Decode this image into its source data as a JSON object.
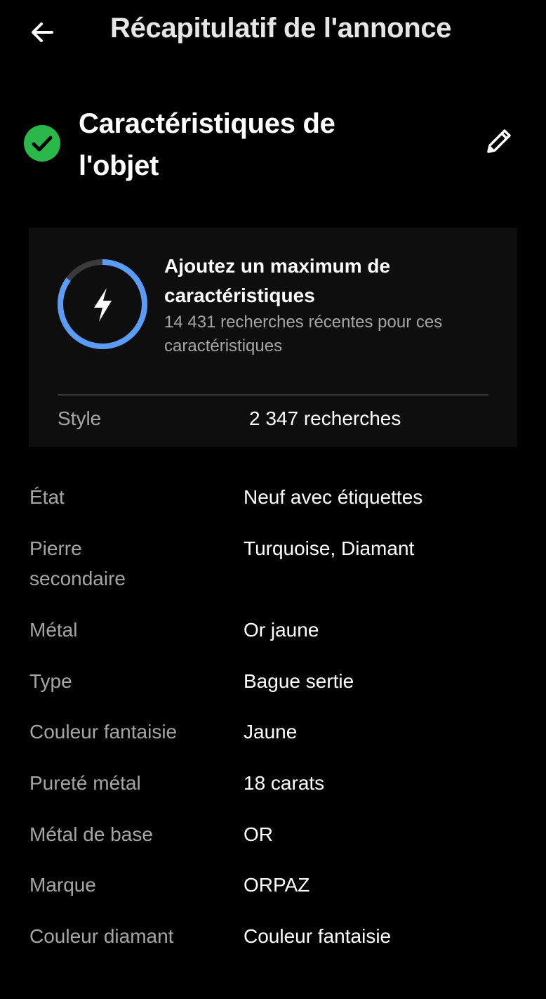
{
  "header": {
    "back_icon": "arrow-left-icon",
    "title": "Récapitulatif de l'annonce"
  },
  "section": {
    "status_icon": "check-circle-icon",
    "status_color": "#2bb84a",
    "title_line1": "Caractéristiques de",
    "title_line2": "l'objet",
    "edit_icon": "pencil-icon"
  },
  "promo": {
    "ring_color": "#5a9cf8",
    "ring_track_color": "#3a3a3a",
    "ring_progress": 0.85,
    "center_icon": "lightning-icon",
    "headline_line1": "Ajoutez un maximum de",
    "headline_line2": "caractéristiques",
    "sub_line1": "14 431 recherches récentes pour ces",
    "sub_line2": "caractéristiques",
    "row": {
      "label": "Style",
      "value": "2 347 recherches"
    }
  },
  "specs": [
    {
      "label": "État",
      "value": "Neuf avec étiquettes"
    },
    {
      "label": "Pierre secondaire",
      "label_line1": "Pierre",
      "label_line2": "secondaire",
      "value": "Turquoise, Diamant"
    },
    {
      "label": "Métal",
      "value": "Or jaune"
    },
    {
      "label": "Type",
      "value": "Bague sertie"
    },
    {
      "label": "Couleur fantaisie",
      "value": "Jaune"
    },
    {
      "label": "Pureté métal",
      "value": "18 carats"
    },
    {
      "label": "Métal de base",
      "value": "OR"
    },
    {
      "label": "Marque",
      "value": "ORPAZ"
    },
    {
      "label": "Couleur diamant",
      "value": "Couleur fantaisie"
    }
  ]
}
